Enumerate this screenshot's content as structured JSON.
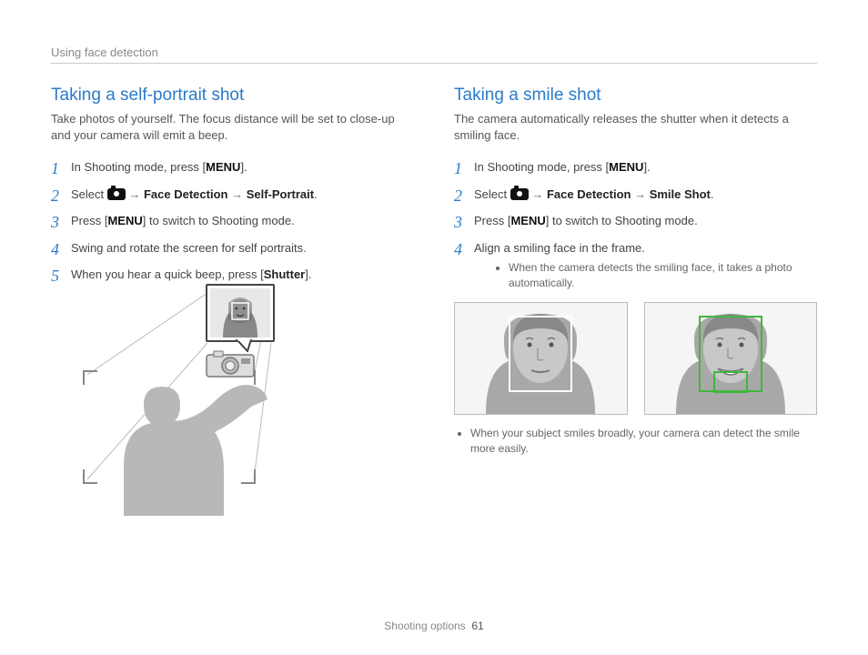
{
  "header": "Using face detection",
  "left": {
    "title": "Taking a self-portrait shot",
    "lead": "Take photos of yourself. The focus distance will be set to close-up and your camera will emit a beep.",
    "step1_a": "In Shooting mode, press [",
    "step1_menu": "MENU",
    "step1_b": "].",
    "step2_a": "Select ",
    "step2_arrow": " → ",
    "step2_b": "Face Detection",
    "step2_c": "Self-Portrait",
    "step2_d": ".",
    "step3_a": "Press [",
    "step3_menu": "MENU",
    "step3_b": "] to switch to Shooting mode.",
    "step4": "Swing and rotate the screen for self portraits.",
    "step5_a": "When you hear a quick beep, press [",
    "step5_b": "Shutter",
    "step5_c": "]."
  },
  "right": {
    "title": "Taking a smile shot",
    "lead": "The camera automatically releases the shutter when it detects a smiling face.",
    "step1_a": "In Shooting mode, press [",
    "step1_menu": "MENU",
    "step1_b": "].",
    "step2_a": "Select ",
    "step2_arrow": " → ",
    "step2_b": "Face Detection",
    "step2_c": "Smile Shot",
    "step2_d": ".",
    "step3_a": "Press [",
    "step3_menu": "MENU",
    "step3_b": "] to switch to Shooting mode.",
    "step4": "Align a smiling face in the frame.",
    "bullet1": "When the camera detects the smiling face, it takes a photo automatically.",
    "bullet2": "When your subject smiles broadly, your camera can detect the smile more easily."
  },
  "footer": {
    "section": "Shooting options",
    "page": "61"
  }
}
